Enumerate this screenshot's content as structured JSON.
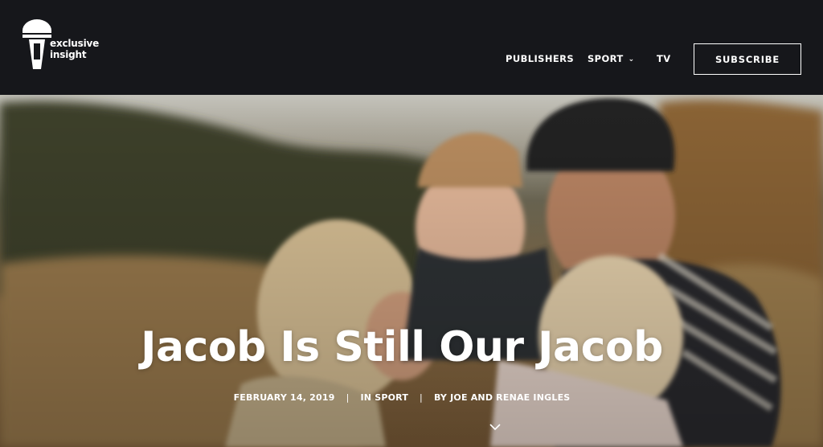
{
  "brand": {
    "name_line1": "exclusive",
    "name_line2": "insight",
    "logo_icon": "microphone-icon"
  },
  "nav": {
    "items": [
      {
        "label": "PUBLISHERS"
      },
      {
        "label": "SPORT",
        "has_dropdown": true,
        "icon": "chevron-down-icon"
      },
      {
        "label": "TV"
      }
    ],
    "subscribe_label": "SUBSCRIBE"
  },
  "hero": {
    "title": "Jacob Is Still Our Jacob",
    "date": "FEBRUARY 14, 2019",
    "category": "IN SPORT",
    "author": "BY JOE AND RENAE INGLES",
    "scroll_icon": "chevron-down-icon"
  },
  "colors": {
    "header_bg": "#16171b",
    "text": "#ffffff"
  }
}
